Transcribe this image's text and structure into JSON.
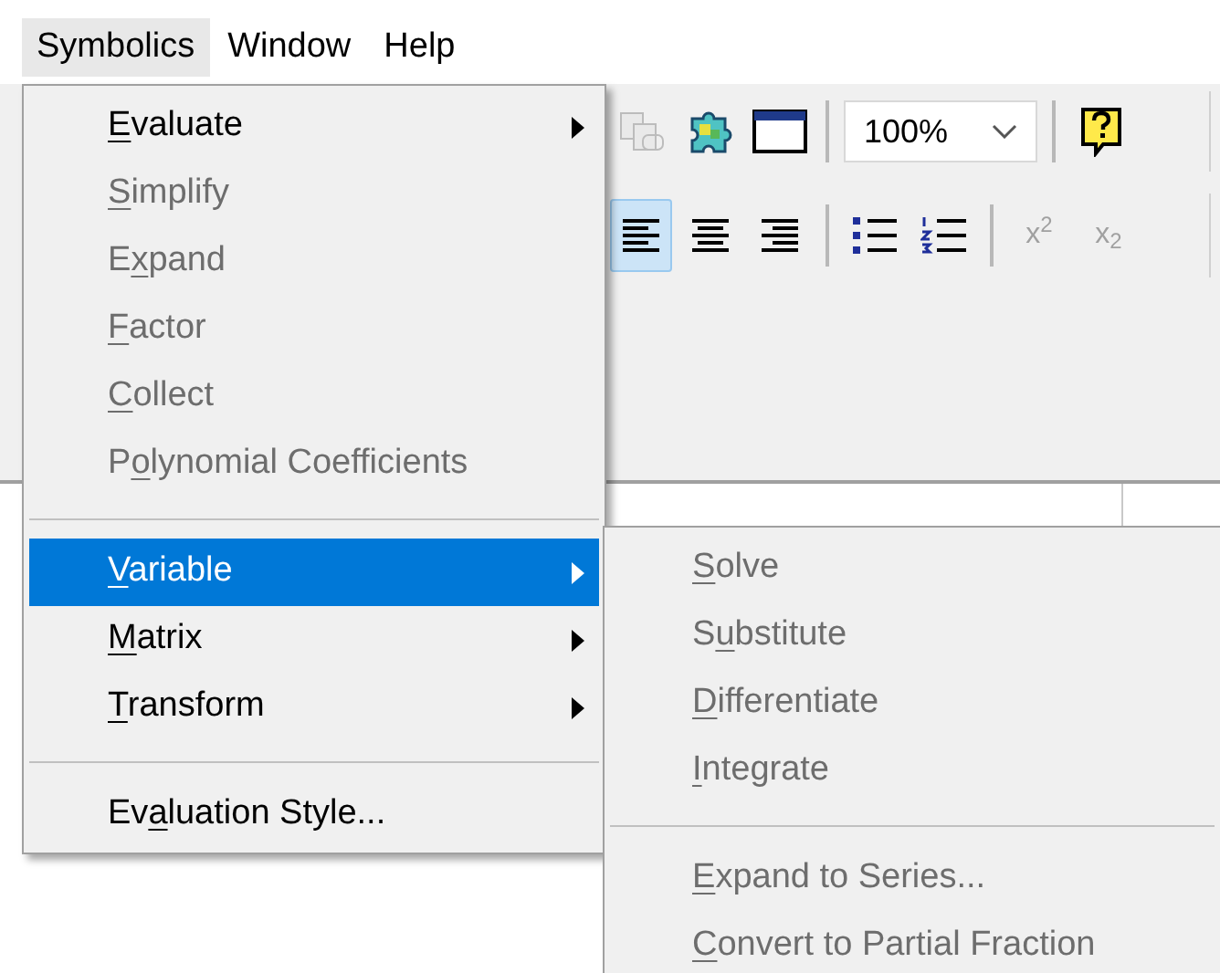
{
  "menu_bar": [
    {
      "label": "Symbolics",
      "selected": true
    },
    {
      "label": "Window",
      "selected": false
    },
    {
      "label": "Help",
      "selected": false
    }
  ],
  "toolbar_row_1": [
    {
      "kind": "copy",
      "disabled": true
    },
    {
      "kind": "addin",
      "disabled": false
    },
    {
      "kind": "window",
      "disabled": false
    },
    {
      "kind": "separator"
    },
    {
      "kind": "zoom",
      "value": "100%"
    },
    {
      "kind": "separator"
    },
    {
      "kind": "help",
      "disabled": false
    }
  ],
  "toolbar_row_2": [
    {
      "kind": "alignleft",
      "selected": true,
      "disabled": false
    },
    {
      "kind": "aligncenter",
      "selected": false,
      "disabled": false
    },
    {
      "kind": "alignright",
      "selected": false,
      "disabled": false
    },
    {
      "kind": "separator"
    },
    {
      "kind": "bullets",
      "selected": false,
      "disabled": false
    },
    {
      "kind": "numbering",
      "selected": false,
      "disabled": false
    },
    {
      "kind": "separator"
    },
    {
      "kind": "script",
      "label": "x$^{2}$",
      "selected": false,
      "disabled": true
    },
    {
      "kind": "script",
      "label": "x$_{2}$",
      "selected": false,
      "disabled": true
    }
  ],
  "menu": [
    {
      "kind": "item",
      "access_key": "E",
      "label_end": "valuate",
      "disabled": false,
      "submenu": true,
      "selected": false
    },
    {
      "kind": "item",
      "access_key": "S",
      "label_end": "implify",
      "disabled": true,
      "submenu": false,
      "selected": false
    },
    {
      "kind": "item",
      "label_start": "E",
      "access_key": "x",
      "label_end": "pand",
      "disabled": true,
      "submenu": false,
      "selected": false
    },
    {
      "kind": "item",
      "access_key": "F",
      "label_end": "actor",
      "disabled": true,
      "submenu": false,
      "selected": false
    },
    {
      "kind": "item",
      "access_key": "C",
      "label_end": "ollect",
      "disabled": true,
      "submenu": false,
      "selected": false
    },
    {
      "kind": "item",
      "label_start": "P",
      "access_key": "o",
      "label_end": "lynomial Coefficients",
      "disabled": true,
      "submenu": false,
      "selected": false
    },
    {
      "kind": "separator"
    },
    {
      "kind": "item",
      "access_key": "V",
      "label_end": "ariable",
      "disabled": false,
      "submenu": true,
      "selected": true
    },
    {
      "kind": "item",
      "access_key": "M",
      "label_end": "atrix",
      "disabled": false,
      "submenu": true,
      "selected": false
    },
    {
      "kind": "item",
      "access_key": "T",
      "label_end": "ransform",
      "disabled": false,
      "submenu": true,
      "selected": false
    },
    {
      "kind": "separator"
    },
    {
      "kind": "item",
      "label_start": "Ev",
      "access_key": "a",
      "label_end": "luation Style...",
      "disabled": false,
      "submenu": false,
      "selected": false
    }
  ],
  "submenu": [
    {
      "kind": "item",
      "access_key": "S",
      "label_end": "olve",
      "disabled": true,
      "submenu": false,
      "selected": false
    },
    {
      "kind": "item",
      "label_start": "S",
      "access_key": "u",
      "label_end": "bstitute",
      "disabled": true,
      "submenu": false,
      "selected": false
    },
    {
      "kind": "item",
      "access_key": "D",
      "label_end": "ifferentiate",
      "disabled": true,
      "submenu": false,
      "selected": false
    },
    {
      "kind": "item",
      "access_key": "I",
      "label_end": "ntegrate",
      "disabled": true,
      "submenu": false,
      "selected": false
    },
    {
      "kind": "separator"
    },
    {
      "kind": "item",
      "access_key": "E",
      "label_end": "xpand to Series...",
      "disabled": true,
      "submenu": false,
      "selected": false
    },
    {
      "kind": "item",
      "access_key": "C",
      "label_end": "onvert to Partial Fraction",
      "disabled": true,
      "submenu": false,
      "selected": false
    }
  ]
}
